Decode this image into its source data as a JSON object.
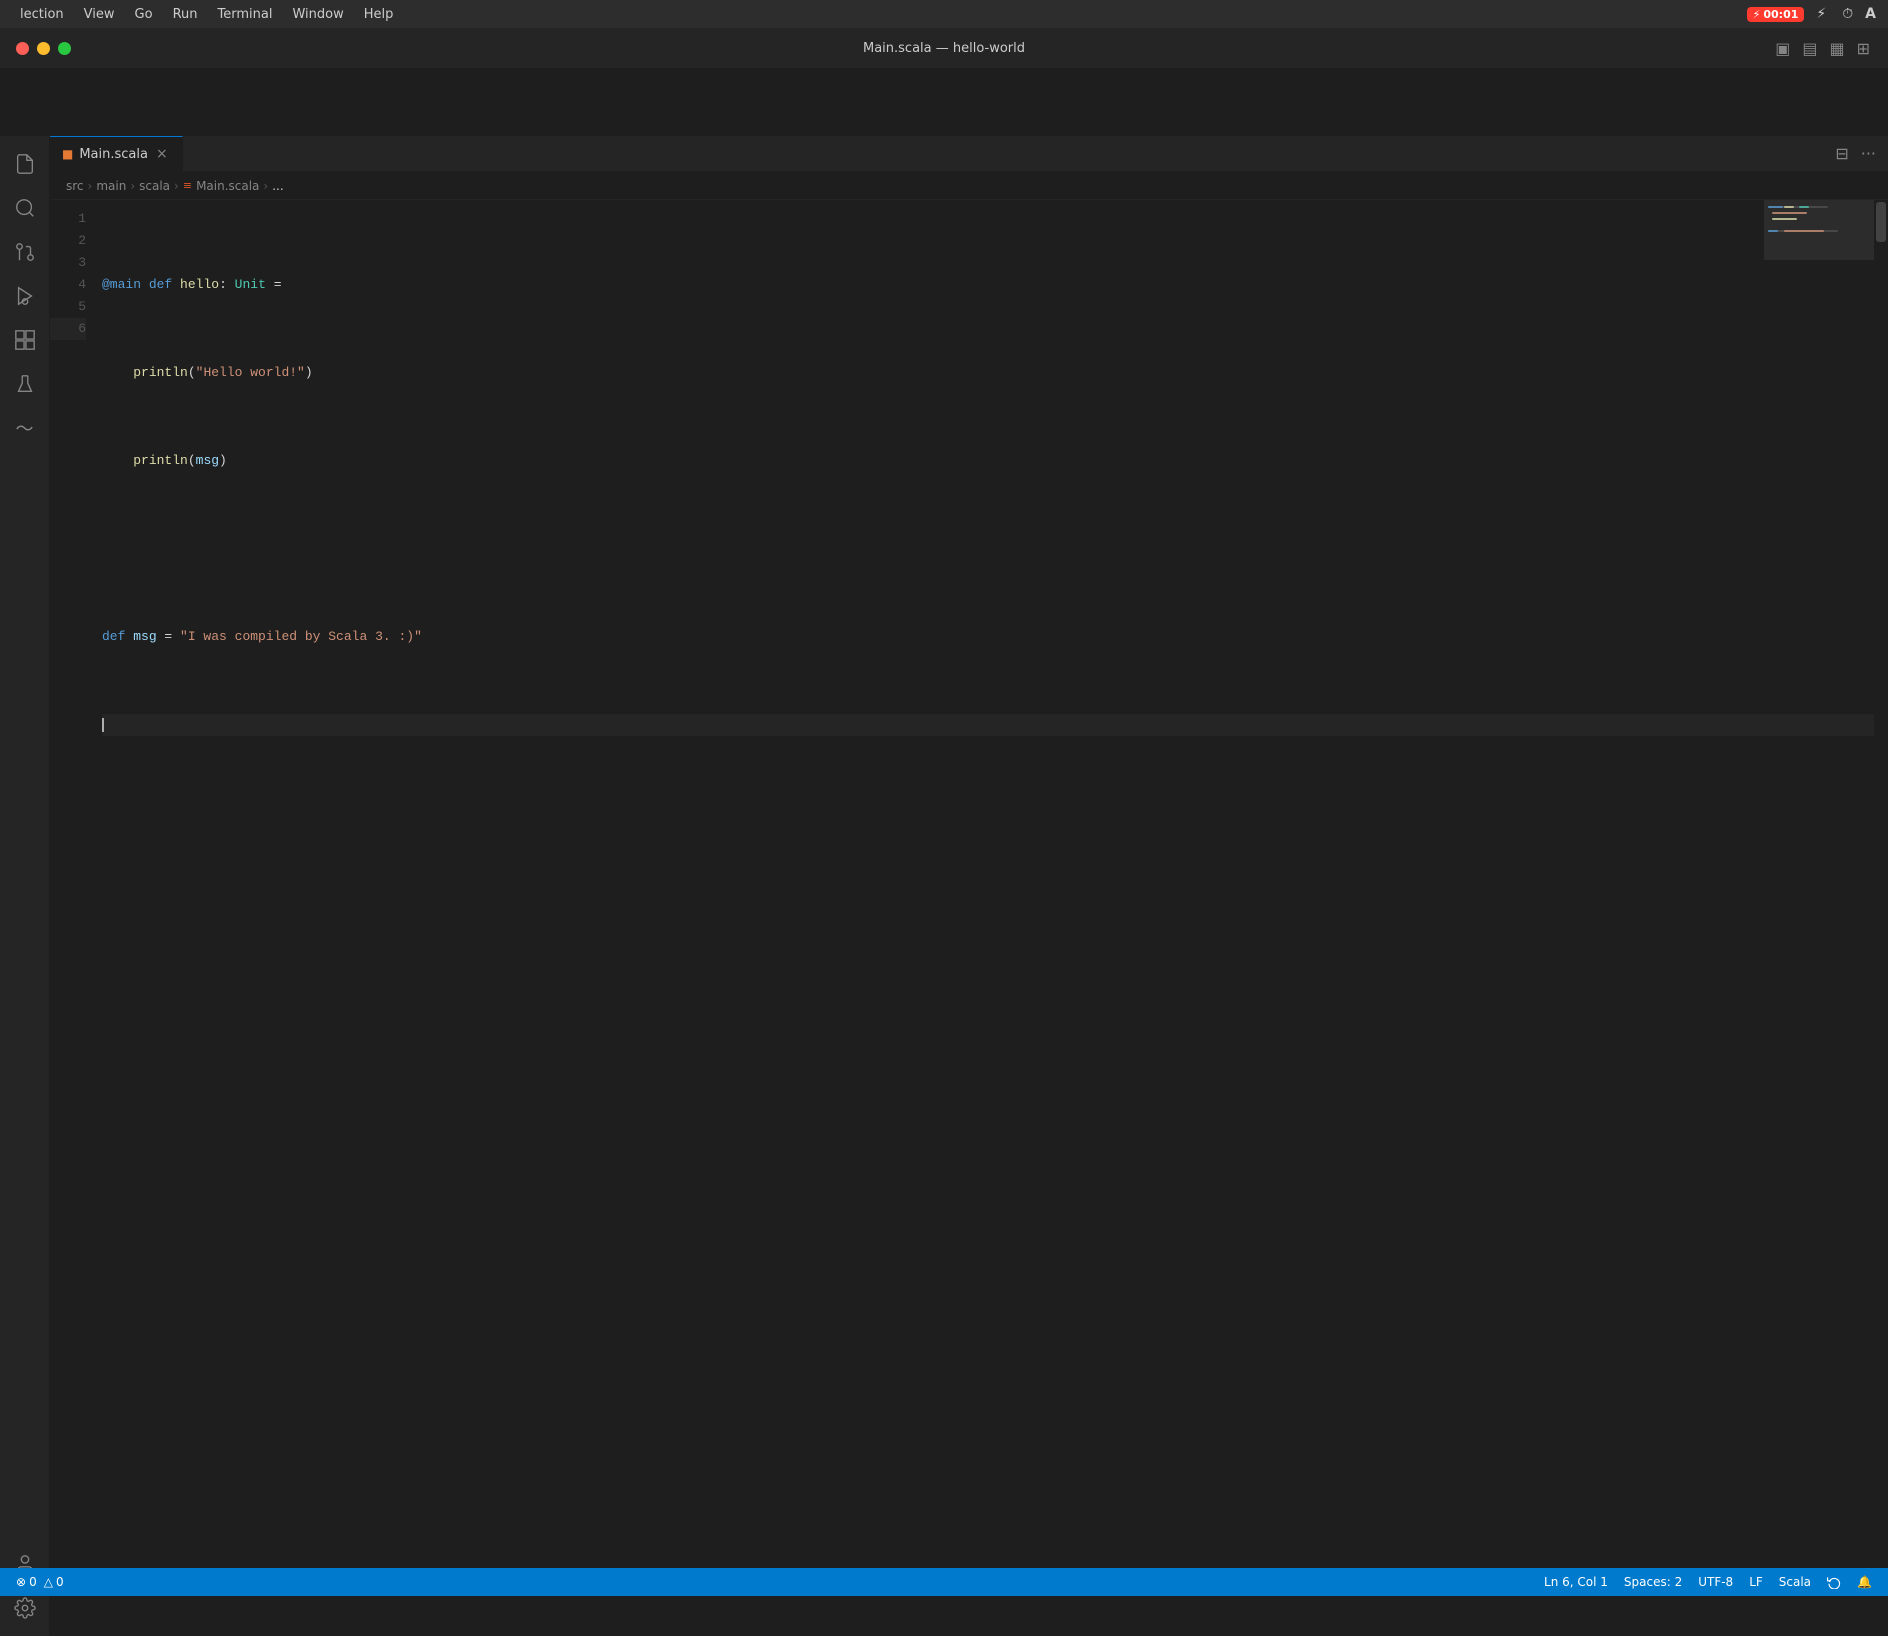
{
  "menubar": {
    "items": [
      "lection",
      "View",
      "Go",
      "Run",
      "Terminal",
      "Window",
      "Help"
    ],
    "battery": "00:01",
    "a_label": "A"
  },
  "titlebar": {
    "title": "Main.scala — hello-world",
    "traffic": [
      "close",
      "minimize",
      "maximize"
    ]
  },
  "tabs": {
    "active_tab_label": "Main.scala",
    "close_label": "×",
    "split_label": "⊟",
    "more_label": "···"
  },
  "breadcrumb": {
    "src": "src",
    "main": "main",
    "scala": "scala",
    "file": "Main.scala",
    "ellipsis": "..."
  },
  "code": {
    "lines": [
      {
        "num": 1,
        "content": "@main def hello: Unit ="
      },
      {
        "num": 2,
        "content": "    println(\"Hello world!\")"
      },
      {
        "num": 3,
        "content": "    println(msg)"
      },
      {
        "num": 4,
        "content": ""
      },
      {
        "num": 5,
        "content": "def msg = \"I was compiled by Scala 3. :)\""
      },
      {
        "num": 6,
        "content": ""
      }
    ]
  },
  "statusbar": {
    "error_count": "0",
    "warning_count": "0",
    "ln_col": "Ln 6, Col 1",
    "spaces": "Spaces: 2",
    "encoding": "UTF-8",
    "line_ending": "LF",
    "language": "Scala",
    "notifications_icon": "🔔"
  },
  "icons": {
    "files": "📄",
    "search": "🔍",
    "source_control": "⎇",
    "run": "▶",
    "extensions": "⊞",
    "beaker": "⚗",
    "wave": "〜",
    "account": "👤",
    "settings": "⚙"
  }
}
